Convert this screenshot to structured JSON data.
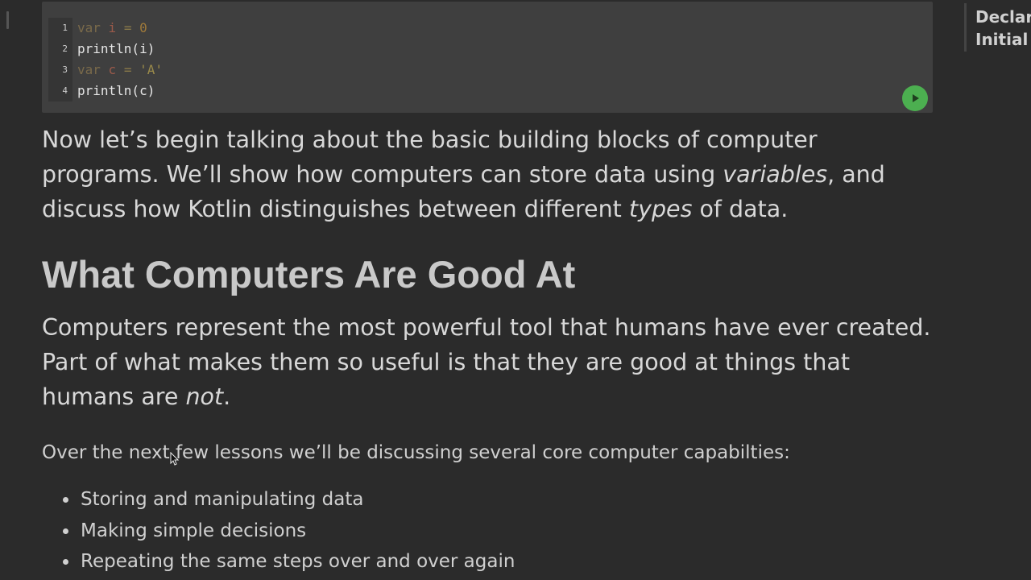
{
  "code_editor": {
    "lines": [
      {
        "no": "1",
        "tokens": [
          {
            "t": "var",
            "c": "kw"
          },
          {
            "t": " ",
            "c": "plain"
          },
          {
            "t": "i",
            "c": "var"
          },
          {
            "t": " = ",
            "c": "op"
          },
          {
            "t": "0",
            "c": "num"
          }
        ]
      },
      {
        "no": "2",
        "tokens": [
          {
            "t": "println(i)",
            "c": "plain"
          }
        ]
      },
      {
        "no": "3",
        "tokens": [
          {
            "t": "var",
            "c": "kw"
          },
          {
            "t": " ",
            "c": "plain"
          },
          {
            "t": "c",
            "c": "var"
          },
          {
            "t": " = ",
            "c": "op"
          },
          {
            "t": "'A'",
            "c": "str"
          }
        ]
      },
      {
        "no": "4",
        "tokens": [
          {
            "t": "println(c)",
            "c": "plain"
          }
        ]
      }
    ],
    "run_icon": "play-icon",
    "run_color": "#4caf50"
  },
  "intro": {
    "part1": "Now let’s begin talking about the basic building blocks of computer programs. We’ll show how computers can store data using ",
    "em1": "variables",
    "part2": ", and discuss how Kotlin distinguishes between different ",
    "em2": "types",
    "part3": " of data."
  },
  "section": {
    "heading": "What Computers Are Good At",
    "para_part1": "Computers represent the most powerful tool that humans have ever created. Part of what makes them so useful is that they are good at things that humans are ",
    "para_em": "not",
    "para_part2": ".",
    "lessons_text": "Over the next few lessons we’ll be discussing several core computer capabilties:",
    "capabilities": [
      "Storing and manipulating data",
      "Making simple decisions",
      "Repeating the same steps over and over again"
    ]
  },
  "toc": {
    "items": [
      "Declar",
      "Initial"
    ]
  }
}
